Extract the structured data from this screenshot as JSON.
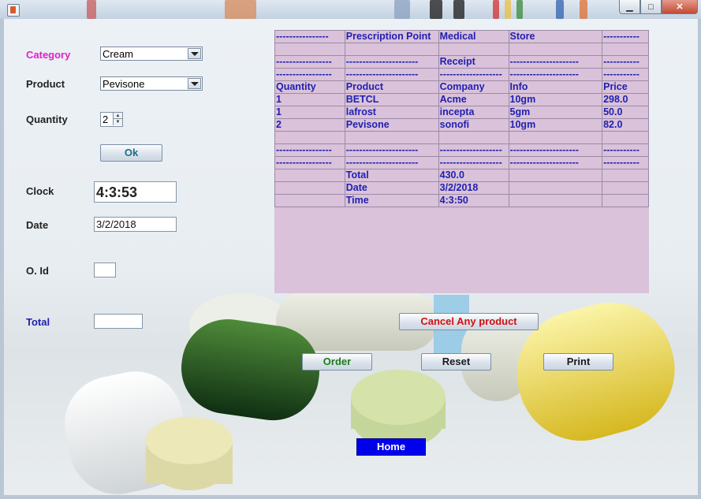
{
  "window": {
    "min_label": "▁",
    "max_label": "□",
    "close_label": "✕"
  },
  "form": {
    "category_label": "Category",
    "category_value": "Cream",
    "product_label": "Product",
    "product_value": "Pevisone",
    "quantity_label": "Quantity",
    "quantity_value": "2",
    "ok_button": "Ok",
    "clock_label": "Clock",
    "clock_value": "4:3:53",
    "date_label": "Date",
    "date_value": "3/2/2018",
    "oid_label": "O. Id",
    "oid_value": "",
    "total_label": "Total",
    "total_value": ""
  },
  "buttons": {
    "cancel": "Cancel Any product",
    "order": "Order",
    "reset": "Reset",
    "print": "Print",
    "home": "Home"
  },
  "receipt": {
    "rows": [
      [
        "----------------",
        "Prescription  Point",
        "Medical",
        "Store",
        "-----------"
      ],
      [
        "",
        "",
        "",
        "",
        ""
      ],
      [
        "-----------------",
        "----------------------",
        "Receipt",
        "---------------------",
        "-----------"
      ],
      [
        "-----------------",
        "----------------------",
        "-------------------",
        "---------------------",
        "-----------"
      ],
      [
        "Quantity",
        "Product",
        "Company",
        "Info",
        "Price"
      ],
      [
        "1",
        "BETCL",
        "Acme",
        "10gm",
        "298.0"
      ],
      [
        "1",
        "lafrost",
        "incepta",
        "5gm",
        "50.0"
      ],
      [
        "2",
        "Pevisone",
        "sonofi",
        "10gm",
        "82.0"
      ],
      [
        "",
        "",
        "",
        "",
        ""
      ],
      [
        "-----------------",
        "----------------------",
        "-------------------",
        "---------------------",
        "-----------"
      ],
      [
        "-----------------",
        "----------------------",
        "-------------------",
        "---------------------",
        "-----------"
      ],
      [
        "",
        "Total",
        "430.0",
        "",
        ""
      ],
      [
        "",
        "Date",
        "3/2/2018",
        "",
        ""
      ],
      [
        "",
        "Time",
        "4:3:50",
        "",
        ""
      ]
    ]
  },
  "colors": {
    "category_label": "#e020c8",
    "total_label": "#1f1fb0",
    "receipt_bg": "#dac2da",
    "receipt_text": "#1f1fb0",
    "cancel_text": "#d01010",
    "order_text": "#1d7a1d",
    "ok_text": "#1a6e86",
    "home_bg": "#0000ee"
  }
}
